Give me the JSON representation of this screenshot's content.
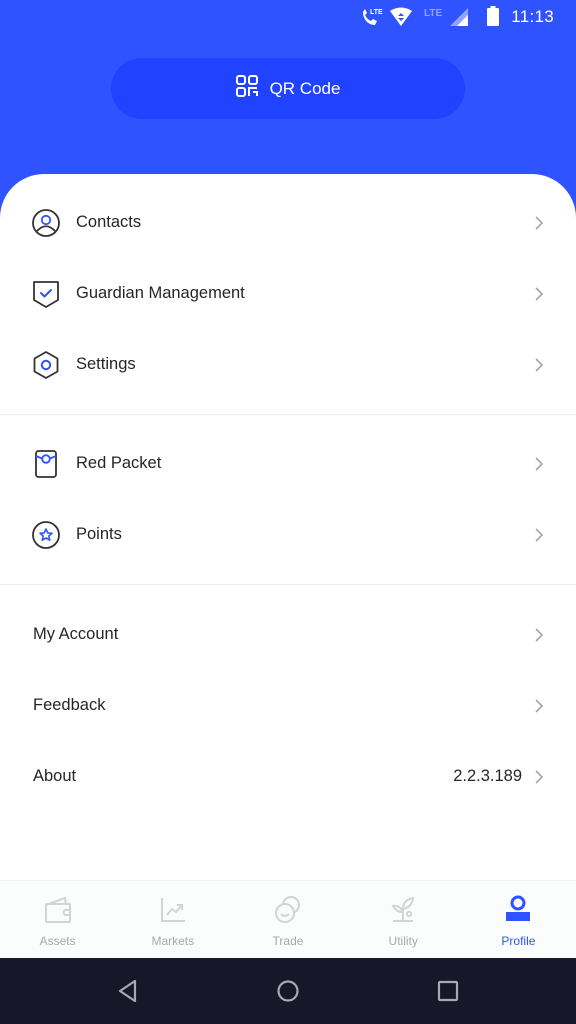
{
  "status_bar": {
    "time": "11:13",
    "icons": [
      "volte-call-icon",
      "data-transfer-icon",
      "lte-signal-icon",
      "signal-strength-icon",
      "battery-icon"
    ],
    "lte_label": "LTE"
  },
  "header": {
    "qr_button": {
      "label": "QR Code",
      "icon": "qr-code-icon"
    },
    "accent_color": "#2f54ff"
  },
  "menu": {
    "sections": [
      {
        "items": [
          {
            "label": "Contacts",
            "icon": "contacts-icon"
          },
          {
            "label": "Guardian Management",
            "icon": "guardian-shield-icon"
          },
          {
            "label": "Settings",
            "icon": "settings-hexagon-icon"
          }
        ]
      },
      {
        "items": [
          {
            "label": "Red Packet",
            "icon": "red-packet-icon"
          },
          {
            "label": "Points",
            "icon": "points-star-icon"
          }
        ]
      },
      {
        "items": [
          {
            "label": "My Account"
          },
          {
            "label": "Feedback"
          },
          {
            "label": "About",
            "value": "2.2.3.189"
          }
        ]
      }
    ]
  },
  "tab_bar": {
    "tabs": [
      {
        "label": "Assets",
        "icon": "wallet-icon",
        "active": false
      },
      {
        "label": "Markets",
        "icon": "chart-trend-icon",
        "active": false
      },
      {
        "label": "Trade",
        "icon": "coins-icon",
        "active": false
      },
      {
        "label": "Utility",
        "icon": "sprout-icon",
        "active": false
      },
      {
        "label": "Profile",
        "icon": "profile-icon",
        "active": true
      }
    ],
    "active_color": "#2f54ff",
    "inactive_color": "#a9a9a9"
  },
  "nav_bar": {
    "buttons": [
      "back",
      "home",
      "recents"
    ]
  }
}
